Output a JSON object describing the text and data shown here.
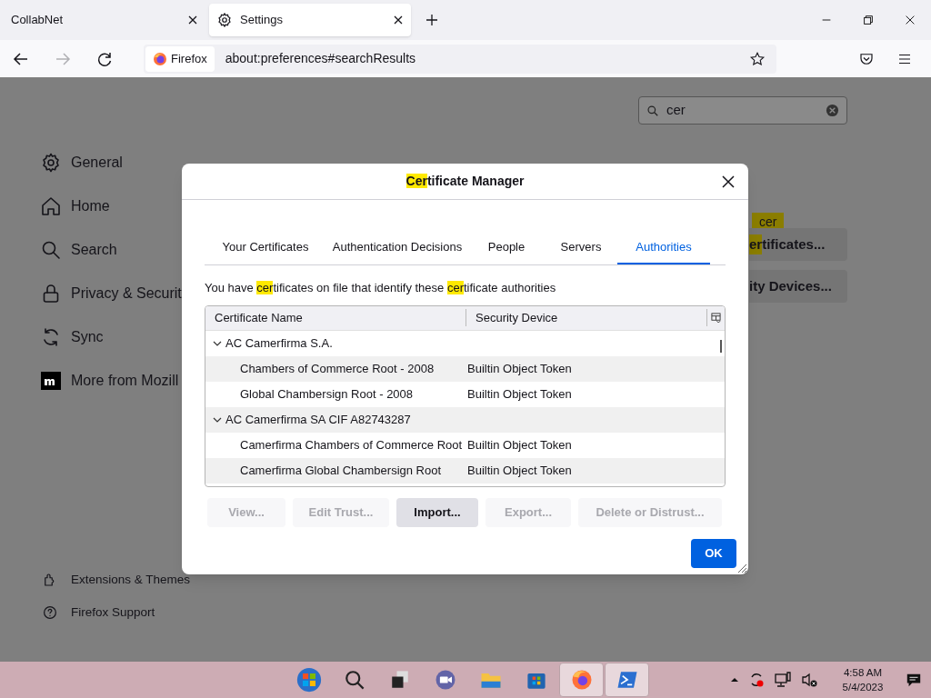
{
  "browser_tabs": [
    {
      "title": "CollabNet",
      "selected": false
    },
    {
      "title": "Settings",
      "selected": true
    }
  ],
  "nav": {
    "back_disabled": false,
    "forward_disabled": true,
    "identity": "Firefox",
    "url": "about:preferences#searchResults"
  },
  "settings": {
    "search": {
      "value": "cer"
    },
    "sidebar": [
      {
        "label": "General"
      },
      {
        "label": "Home"
      },
      {
        "label": "Search"
      },
      {
        "label": "Privacy & Securit"
      },
      {
        "label": "Sync"
      },
      {
        "label": "More from Mozill"
      }
    ],
    "footer_links": [
      {
        "label": "Extensions & Themes"
      },
      {
        "label": "Firefox Support"
      }
    ],
    "tooltip": "cer",
    "result_buttons": [
      {
        "parts": [
          {
            "text": "er",
            "highlighted": true
          },
          {
            "text": "tificates...",
            "highlighted": false
          }
        ]
      },
      {
        "parts": [
          {
            "text": "ity Devices...",
            "highlighted": false
          }
        ]
      }
    ]
  },
  "dialog": {
    "title_parts": [
      {
        "text": "Cer",
        "highlighted": true
      },
      {
        "text": "tificate Manager",
        "highlighted": false
      }
    ],
    "tabs": [
      {
        "label": "Your Certificates",
        "selected": false
      },
      {
        "label": "Authentication Decisions",
        "selected": false
      },
      {
        "label": "People",
        "selected": false
      },
      {
        "label": "Servers",
        "selected": false
      },
      {
        "label": "Authorities",
        "selected": true
      }
    ],
    "description_parts": [
      {
        "text": "You have ",
        "highlighted": false
      },
      {
        "text": "cer",
        "highlighted": true
      },
      {
        "text": "tificates on file that identify these ",
        "highlighted": false
      },
      {
        "text": "cer",
        "highlighted": true
      },
      {
        "text": "tificate authorities",
        "highlighted": false
      }
    ],
    "columns": [
      "Certificate Name",
      "Security Device"
    ],
    "groups": [
      {
        "name": "AC Camerfirma S.A.",
        "expanded": true,
        "children": [
          {
            "name": "Chambers of Commerce Root - 2008",
            "device": "Builtin Object Token"
          },
          {
            "name": "Global Chambersign Root - 2008",
            "device": "Builtin Object Token"
          }
        ]
      },
      {
        "name": "AC Camerfirma SA CIF A82743287",
        "expanded": true,
        "children": [
          {
            "name": "Camerfirma Chambers of Commerce Root",
            "device": "Builtin Object Token"
          },
          {
            "name": "Camerfirma Global Chambersign Root",
            "device": "Builtin Object Token"
          }
        ]
      }
    ],
    "buttons": [
      {
        "label": "View...",
        "disabled": true
      },
      {
        "label": "Edit Trust...",
        "disabled": true
      },
      {
        "label": "Import...",
        "disabled": false
      },
      {
        "label": "Export...",
        "disabled": true
      },
      {
        "label": "Delete or Distrust...",
        "disabled": true
      }
    ],
    "ok": "OK"
  },
  "taskbar": {
    "apps": [
      {
        "kind": "start",
        "active": false
      },
      {
        "kind": "search",
        "active": false
      },
      {
        "kind": "taskview",
        "active": false
      },
      {
        "kind": "chat",
        "active": false
      },
      {
        "kind": "folder",
        "active": false
      },
      {
        "kind": "store",
        "active": false
      },
      {
        "kind": "firefox",
        "active": true
      },
      {
        "kind": "terminal",
        "active": true
      }
    ],
    "time": "4:58 AM",
    "date": "5/4/2023"
  }
}
